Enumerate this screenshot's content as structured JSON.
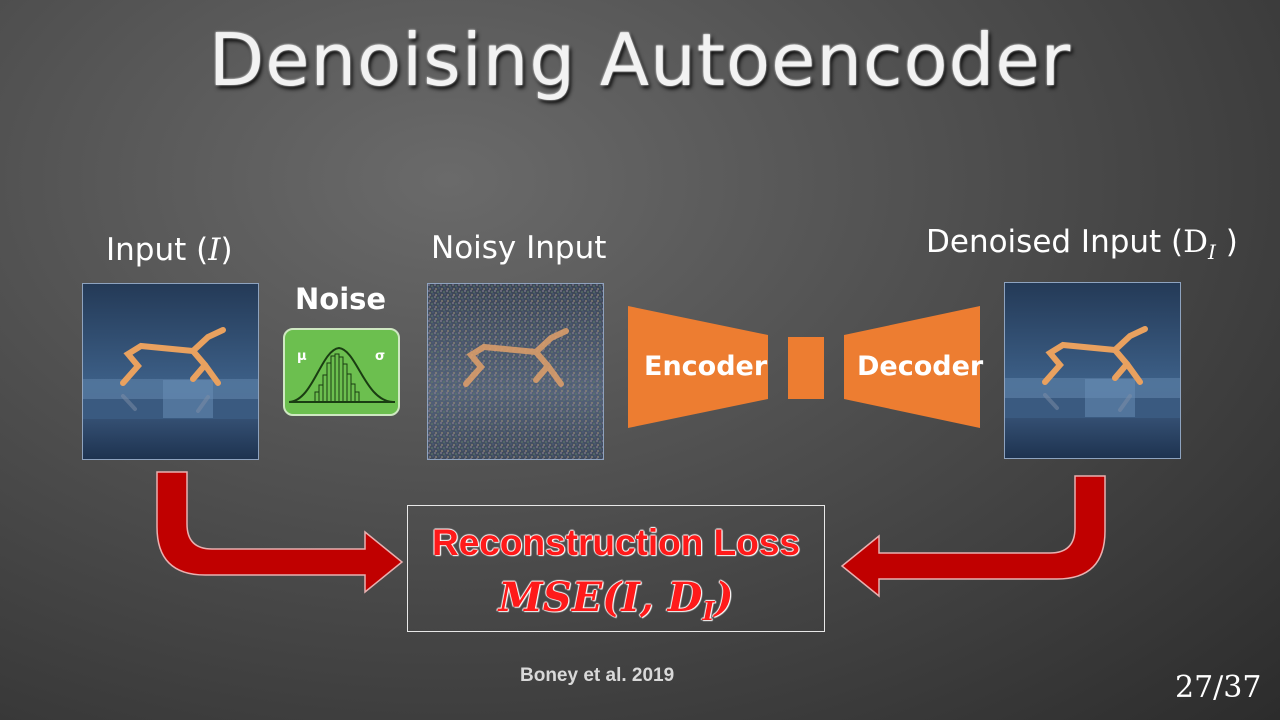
{
  "title": "Denoising Autoencoder",
  "labels": {
    "input_prefix": "Input (",
    "input_var": "I",
    "input_suffix": ")",
    "noise": "Noise",
    "noisy_input": "Noisy Input",
    "denoised_prefix": "Denoised Input (",
    "denoised_var": "D",
    "denoised_sub": "I",
    "denoised_suffix": " )"
  },
  "noise_box": {
    "mu": "μ",
    "sigma": "σ",
    "color": "#6cbf4f"
  },
  "network": {
    "encoder": "Encoder",
    "decoder": "Decoder",
    "color": "#ed7d31"
  },
  "loss": {
    "title": "Reconstruction Loss",
    "formula_prefix": "MSE(I, D",
    "formula_sub": "I",
    "formula_suffix": ")",
    "color": "#ff1a1a"
  },
  "arrows": {
    "color": "#c00000"
  },
  "citation": "Boney et al. 2019",
  "page": "27/37"
}
